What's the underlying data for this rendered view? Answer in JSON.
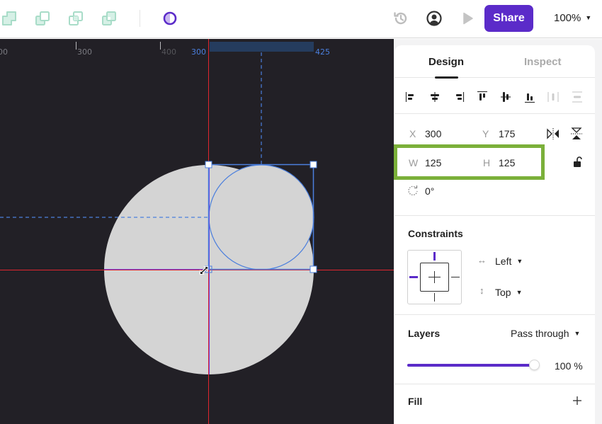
{
  "toolbar": {
    "boolean_icons": [
      "union-icon",
      "subtract-icon",
      "intersect-icon",
      "exclude-icon"
    ],
    "mask_icon": "contrast-mask-icon",
    "history_icon": "history-icon",
    "user_icon": "user-circle-icon",
    "play_icon": "play-icon",
    "share_label": "Share",
    "zoom_level": "100%"
  },
  "colors": {
    "accent": "#5b2bc9",
    "canvas_bg": "#222026",
    "shape_fill": "#d4d4d4",
    "selection": "#4b7fdd",
    "guide_red": "#e0262f",
    "highlight": "#7bb03a",
    "boolean_icon": "#a8dcc8"
  },
  "ruler": {
    "labels": [
      "00",
      "300",
      "400"
    ],
    "selection_start": "300",
    "selection_end": "425"
  },
  "panel": {
    "tabs": [
      {
        "label": "Design",
        "active": true
      },
      {
        "label": "Inspect",
        "active": false
      }
    ],
    "align_icons": [
      "align-left-icon",
      "align-center-horizontal-icon",
      "align-right-icon",
      "align-top-icon",
      "align-center-vertical-icon",
      "align-bottom-icon",
      "distribute-horizontal-icon",
      "distribute-vertical-icon"
    ],
    "transform": {
      "x_label": "X",
      "x_value": "300",
      "y_label": "Y",
      "y_value": "175",
      "w_label": "W",
      "w_value": "125",
      "h_label": "H",
      "h_value": "125",
      "rotation_value": "0°"
    },
    "constraints": {
      "title": "Constraints",
      "horizontal": "Left",
      "vertical": "Top"
    },
    "layers": {
      "title": "Layers",
      "blend_mode": "Pass through",
      "opacity_percent": 100,
      "opacity_label": "100",
      "opacity_unit": "%"
    },
    "fill": {
      "title": "Fill"
    }
  }
}
